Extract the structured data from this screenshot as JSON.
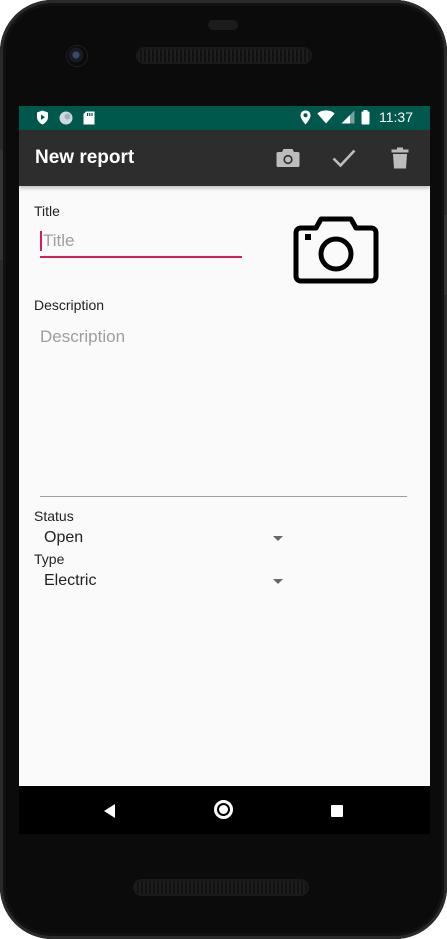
{
  "status_bar": {
    "time": "11:37",
    "icons_left": [
      "shield-icon",
      "circle-icon",
      "sd-card-icon"
    ],
    "icons_right": [
      "location-icon",
      "wifi-icon",
      "signal-icon",
      "battery-icon"
    ],
    "color": "#00574b"
  },
  "toolbar": {
    "title": "New report",
    "actions": [
      "camera-icon",
      "check-icon",
      "delete-icon"
    ],
    "color": "#2d2d2d"
  },
  "form": {
    "title_label": "Title",
    "title_placeholder": "Title",
    "description_label": "Description",
    "description_placeholder": "Description",
    "status_label": "Status",
    "status_value": "Open",
    "type_label": "Type",
    "type_value": "Electric",
    "accent": "#d81b60"
  },
  "nav_bar": {
    "buttons": [
      "back",
      "home",
      "recents"
    ]
  }
}
